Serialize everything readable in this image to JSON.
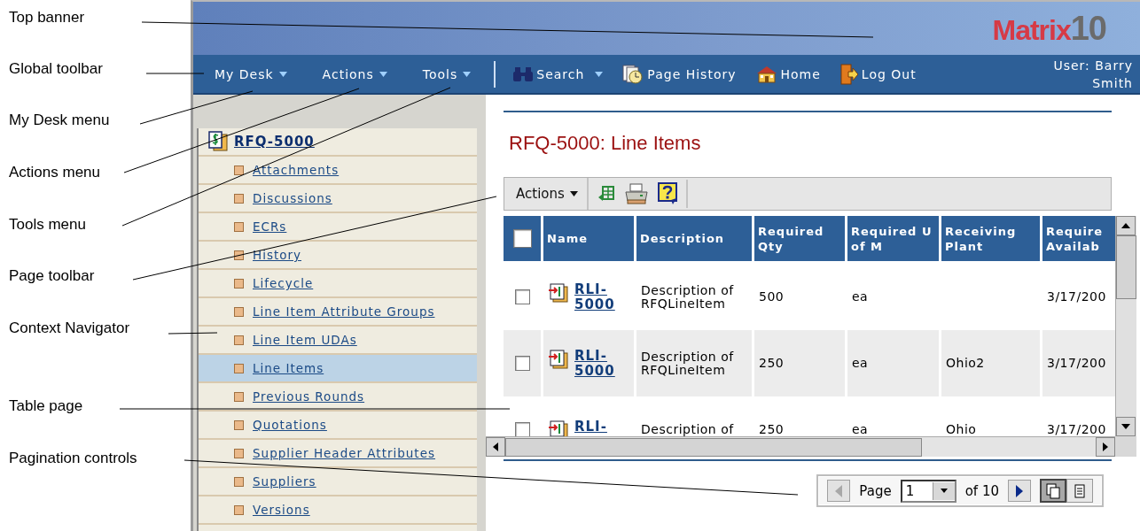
{
  "callouts": [
    "Top banner",
    "Global toolbar",
    "My Desk menu",
    "Actions menu",
    "Tools menu",
    "Page toolbar",
    "Context Navigator",
    "Table page",
    "Pagination controls"
  ],
  "banner": {
    "logo_word": "Matrix",
    "logo_number": "10"
  },
  "global_toolbar": {
    "menus": [
      {
        "label": "My Desk"
      },
      {
        "label": "Actions"
      },
      {
        "label": "Tools"
      }
    ],
    "tools": [
      {
        "label": "Search",
        "dropdown": true
      },
      {
        "label": "Page History",
        "dropdown": false
      },
      {
        "label": "Home",
        "dropdown": false
      },
      {
        "label": "Log Out",
        "dropdown": false
      }
    ],
    "user": "User: Barry Smith"
  },
  "sidebar": {
    "root": "RFQ-5000",
    "items": [
      {
        "label": "Attachments",
        "selected": false
      },
      {
        "label": "Discussions",
        "selected": false
      },
      {
        "label": "ECRs",
        "selected": false
      },
      {
        "label": "History",
        "selected": false
      },
      {
        "label": "Lifecycle",
        "selected": false
      },
      {
        "label": "Line Item Attribute Groups",
        "selected": false
      },
      {
        "label": "Line Item UDAs",
        "selected": false
      },
      {
        "label": "Line Items",
        "selected": true
      },
      {
        "label": "Previous Rounds",
        "selected": false
      },
      {
        "label": "Quotations",
        "selected": false
      },
      {
        "label": "Supplier Header Attributes",
        "selected": false
      },
      {
        "label": "Suppliers",
        "selected": false
      },
      {
        "label": "Versions",
        "selected": false
      }
    ]
  },
  "content": {
    "title": "RFQ-5000: Line Items",
    "page_toolbar": {
      "menu": "Actions"
    },
    "table": {
      "select_all_checked": false,
      "columns": [
        "Name",
        "Description",
        "Required Qty",
        "Required U of M",
        "Receiving Plant",
        "Require Availab"
      ],
      "rows": [
        {
          "checked": false,
          "name": "RLI-5000",
          "description": "Description of RFQLineItem",
          "qty": "500",
          "uom": "ea",
          "date": "3/17/200"
        },
        {
          "checked": false,
          "name": "RLI-5000",
          "description": "Description of RFQLineItem",
          "qty": "250",
          "uom": "ea",
          "plant": "Ohio2",
          "date": "3/17/200"
        },
        {
          "checked": false,
          "name": "RLI-",
          "description": "Description of",
          "qty": "250",
          "uom": "ea",
          "plant": "Ohio",
          "date": "3/17/200"
        }
      ]
    },
    "pagination": {
      "prev_disabled": true,
      "next_disabled": false,
      "page_label": "Page",
      "page": "1",
      "of": "of 10",
      "views": [
        {
          "selected": true
        },
        {
          "selected": false
        }
      ]
    }
  }
}
